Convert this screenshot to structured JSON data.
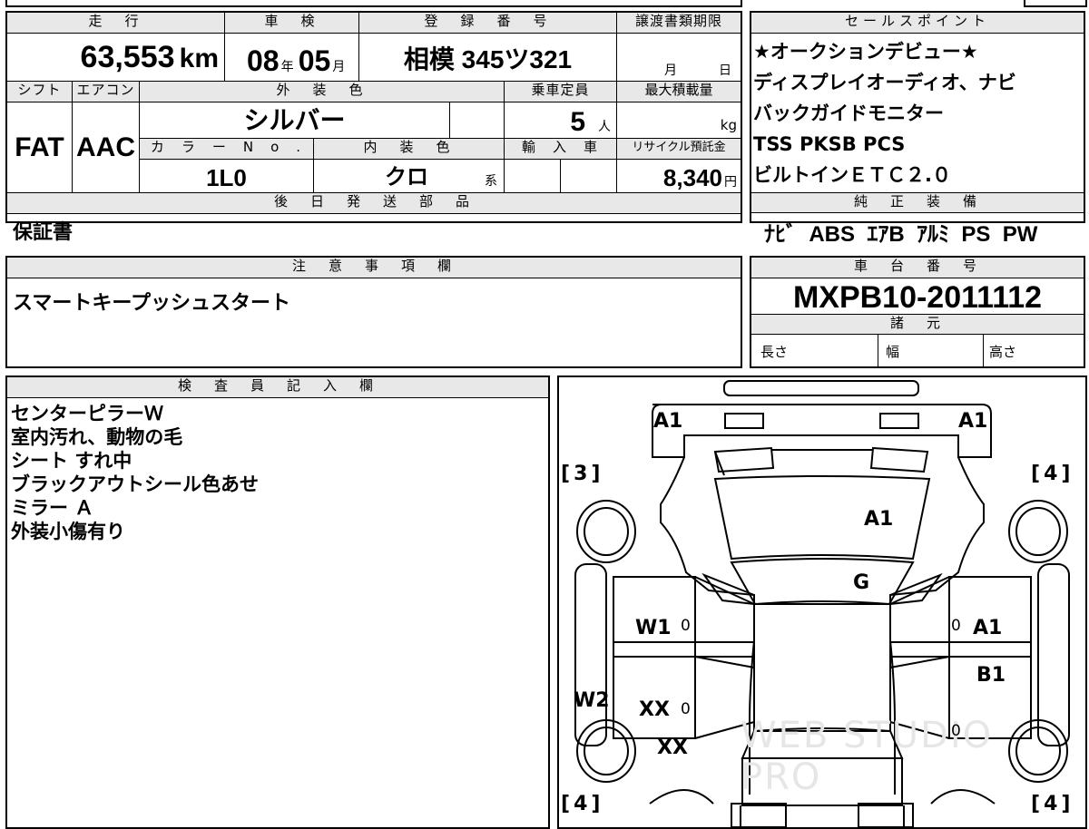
{
  "top_table": {
    "mileage": {
      "label": "走　行",
      "value": "63,553",
      "unit": "km"
    },
    "inspection": {
      "label": "車　検",
      "year": "08",
      "year_unit": "年",
      "month": "05",
      "month_unit": "月"
    },
    "registration": {
      "label": "登　録　番　号",
      "value": "相模  345ツ321"
    },
    "transfer_deadline": {
      "label": "譲渡書類期限",
      "month_unit": "月",
      "day_unit": "日"
    },
    "shift": {
      "label": "シフト",
      "value": "FAT"
    },
    "aircon": {
      "label": "エアコン",
      "value": "AAC"
    },
    "exterior_color": {
      "label": "外　装　色",
      "value": "シルバー"
    },
    "capacity": {
      "label": "乗車定員",
      "value": "5",
      "unit": "人"
    },
    "max_load": {
      "label": "最大積載量",
      "unit": "kg"
    },
    "color_no": {
      "label": "カ　ラ　ー　N　o　.",
      "value": "1L0"
    },
    "interior_color": {
      "label": "内　装　色",
      "value": "クロ",
      "suffix": "系"
    },
    "import": {
      "label": "輸　入　車"
    },
    "recycle": {
      "label": "リサイクル預託金",
      "value": "8,340",
      "unit": "円"
    },
    "later_parts": {
      "label": "後　日　発　送　部　品",
      "value": "保証書"
    }
  },
  "sales_points": {
    "label": "セールスポイント",
    "items": [
      "★オークションデビュー★",
      "ディスプレイオーディオ、ナビ",
      "バックガイドモニター",
      "TSS PKSB PCS",
      "ビルトインＥＴＣ２.０"
    ]
  },
  "standard_equipment": {
    "label": "純　正　装　備",
    "value": "ﾅﾋﾞ  ABS  ｴｱB  ｱﾙﾐ  PS  PW"
  },
  "notes": {
    "label": "注　意　事　項　欄",
    "value": "スマートキープッシュスタート"
  },
  "chassis": {
    "label": "車　台　番　号",
    "value": "MXPB10-2011112"
  },
  "specs": {
    "label": "諸　元",
    "length": "長さ",
    "width": "幅",
    "height": "高さ"
  },
  "inspector": {
    "label": "検　査　員　記　入　欄",
    "lines": [
      "センターピラーＷ",
      "室内汚れ、動物の毛",
      "シート すれ中",
      "ブラックアウトシール色あせ",
      "ミラー Ａ",
      "外装小傷有り"
    ]
  },
  "diagram": {
    "marks": {
      "front_left": "A1",
      "front_right": "A1",
      "hood": "A1",
      "windshield": "G",
      "left_front_door": "W1",
      "right_front_door": "A1",
      "right_rear_door": "B1",
      "left_pillar": "W2",
      "left_rear_door": "XX",
      "left_rear_fender": "XX",
      "zero": "0"
    },
    "tires": {
      "front_left": "3",
      "front_right": "4",
      "rear_left": "4",
      "rear_right": "4"
    },
    "watermark": "WEB STUDIO PRO"
  }
}
